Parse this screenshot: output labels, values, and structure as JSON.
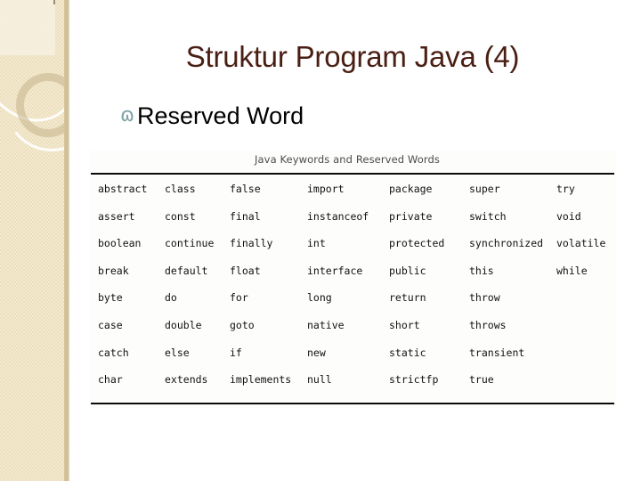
{
  "slide": {
    "title": "Struktur Program Java (4)",
    "bullet_glyph": "ɷ",
    "bullet_text": "Reserved Word",
    "title_color": "#4a1f13",
    "bullet_glyph_color": "#7fa0a8",
    "sidebar_color": "#eddfbc"
  },
  "table": {
    "caption": "Java Keywords and Reserved Words",
    "rows": [
      [
        "abstract",
        "class",
        "false",
        "import",
        "package",
        "super",
        "try"
      ],
      [
        "assert",
        "const",
        "final",
        "instanceof",
        "private",
        "switch",
        "void"
      ],
      [
        "boolean",
        "continue",
        "finally",
        "int",
        "protected",
        "synchronized",
        "volatile"
      ],
      [
        "break",
        "default",
        "float",
        "interface",
        "public",
        "this",
        "while"
      ],
      [
        "byte",
        "do",
        "for",
        "long",
        "return",
        "throw",
        ""
      ],
      [
        "case",
        "double",
        "goto",
        "native",
        "short",
        "throws",
        ""
      ],
      [
        "catch",
        "else",
        "if",
        "new",
        "static",
        "transient",
        ""
      ],
      [
        "char",
        "extends",
        "implements",
        "null",
        "strictfp",
        "true",
        ""
      ]
    ]
  }
}
